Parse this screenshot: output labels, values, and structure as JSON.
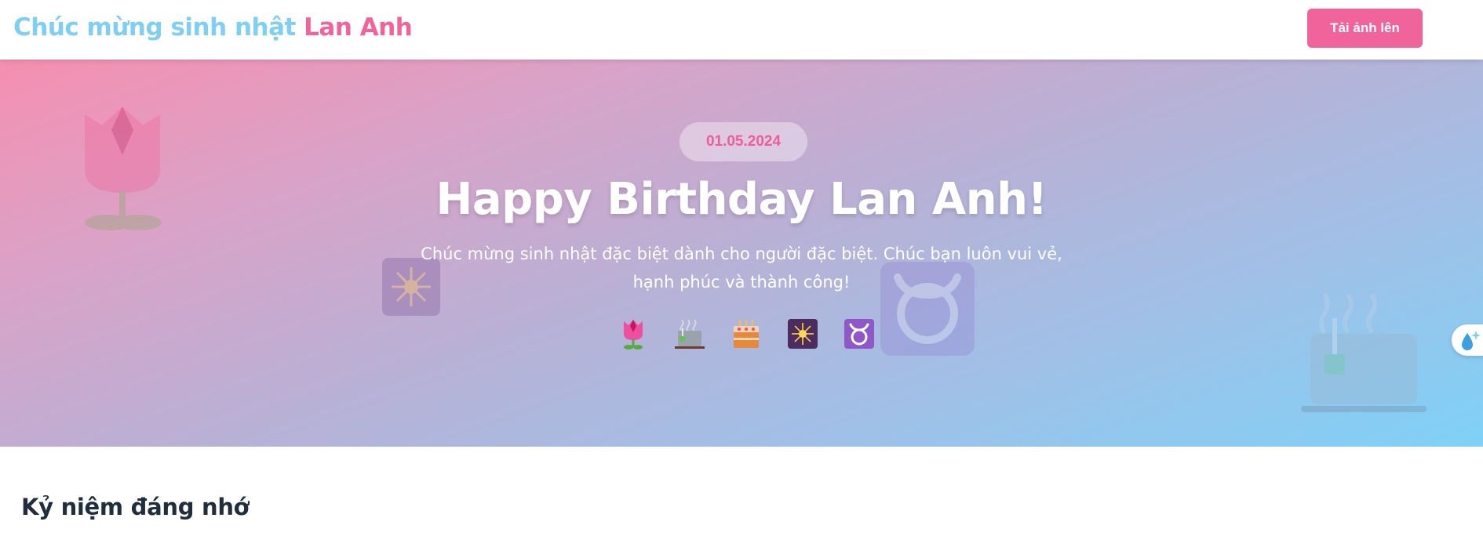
{
  "header": {
    "title_part1": "Chúc mừng sinh nhật",
    "title_part2": "Lan Anh",
    "upload_label": "Tải ảnh lên"
  },
  "hero": {
    "date": "01.05.2024",
    "title": "Happy Birthday Lan Anh!",
    "subtitle": "Chúc mừng sinh nhật đặc biệt dành cho người đặc biệt. Chúc bạn luôn vui vẻ, hạnh phúc và thành công!",
    "emojis": [
      "tulip-icon",
      "tea-icon",
      "birthday-cake-icon",
      "sparkler-icon",
      "taurus-icon"
    ]
  },
  "section": {
    "title": "Kỷ niệm đáng nhớ"
  },
  "colors": {
    "brand_blue": "#7fcff3",
    "brand_pink": "#f0649b",
    "heading_text": "#1f2d3d"
  }
}
